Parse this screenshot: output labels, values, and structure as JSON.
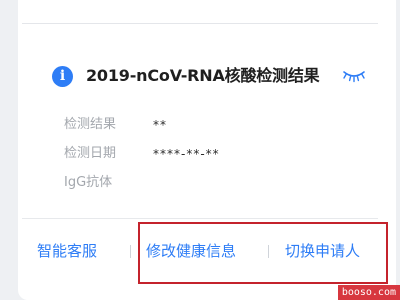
{
  "result_card": {
    "title": "2019-nCoV-RNA核酸检测结果",
    "rows": [
      {
        "label": "检测结果",
        "value": "**"
      },
      {
        "label": "检测日期",
        "value": "****-**-**"
      },
      {
        "label": "IgG抗体",
        "value": ""
      }
    ]
  },
  "footer": {
    "actions": [
      {
        "label": "智能客服"
      },
      {
        "label": "修改健康信息"
      },
      {
        "label": "切换申请人"
      }
    ]
  },
  "watermark": {
    "text": "booso.com"
  },
  "icons": {
    "info": "info-icon",
    "eye": "eye-closed-icon"
  },
  "colors": {
    "accent": "#2e7df6",
    "highlight": "#c4232c",
    "label": "#a3a7ad"
  }
}
